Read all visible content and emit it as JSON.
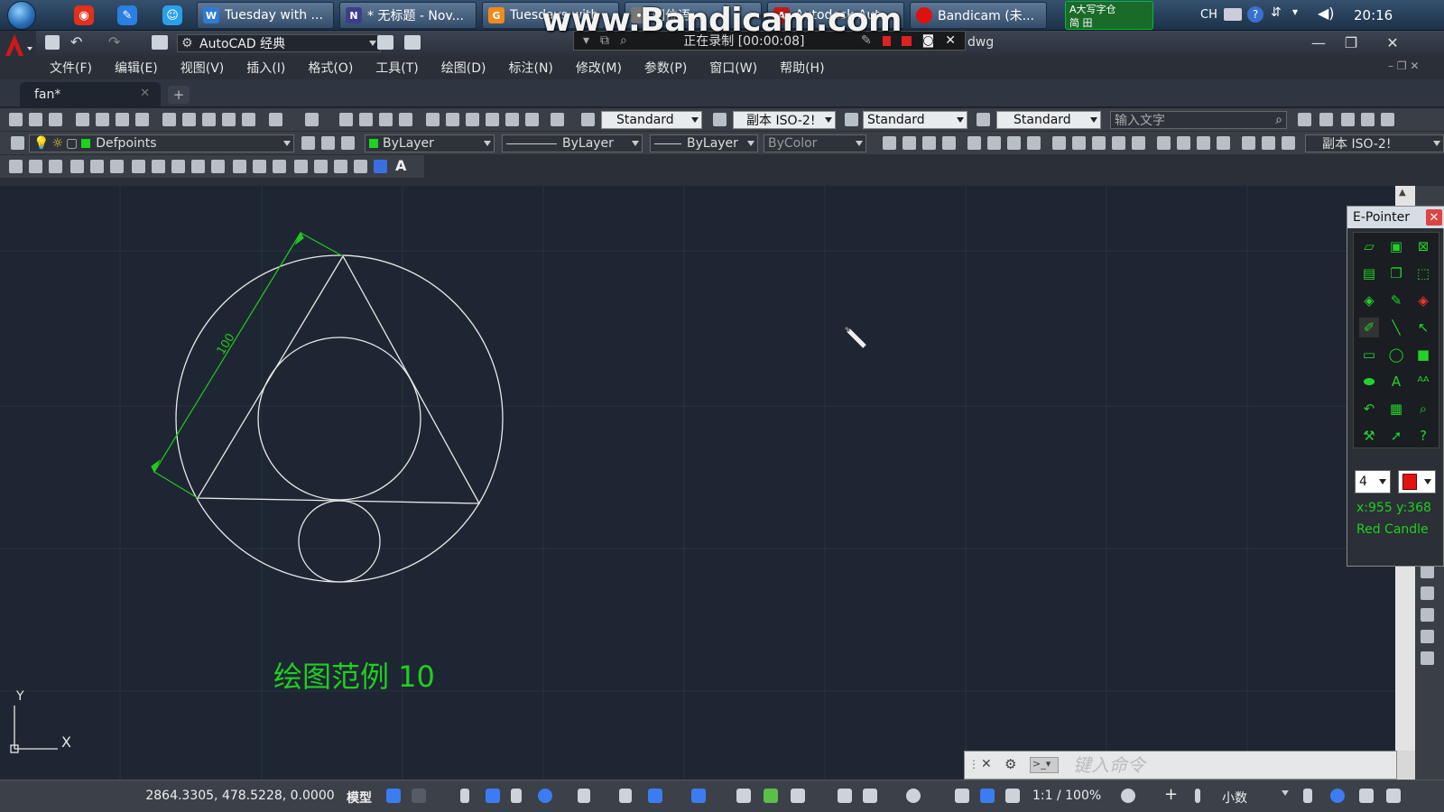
{
  "taskbar": {
    "windows": [
      {
        "label": "Tuesday with ...",
        "icon": "word-doc-icon",
        "color": "#2f7bd6"
      },
      {
        "label": "* 无标题 - Nov...",
        "icon": "notepad-icon",
        "color": "#3d3d8a"
      },
      {
        "label": "Tuesdays with ...",
        "icon": "orange-app-icon",
        "color": "#f08a1c"
      },
      {
        "label": "同位语 ...",
        "icon": "app-icon",
        "color": "#777"
      },
      {
        "label": "Autodesk Aut...",
        "icon": "autocad-icon",
        "color": "#c21a1a"
      },
      {
        "label": "Bandicam (未...",
        "icon": "bandicam-record-icon",
        "color": "#d11"
      }
    ],
    "ime": {
      "line1": "A大写字仓",
      "line2": "简 田"
    },
    "lang": "CH",
    "clock": "20:16"
  },
  "bandicam": {
    "watermark": "www.Bandicam.com",
    "status": "正在录制 [00:00:08]"
  },
  "titlebar": {
    "workspace": "AutoCAD 经典",
    "filename_tail": "dwg",
    "controls": [
      "—",
      "❐",
      "✕"
    ]
  },
  "menubar": {
    "items": [
      "文件(F)",
      "编辑(E)",
      "视图(V)",
      "插入(I)",
      "格式(O)",
      "工具(T)",
      "绘图(D)",
      "标注(N)",
      "修改(M)",
      "参数(P)",
      "窗口(W)",
      "帮助(H)"
    ]
  },
  "tabs": {
    "active": "fan*",
    "close": "✕",
    "add": "+"
  },
  "toolbar_std": {
    "text_style": "Standard",
    "dim_style": "副本 ISO-2!",
    "table_style": "Standard",
    "mleader_style": "Standard",
    "search_placeholder": "输入文字"
  },
  "toolbar_layers": {
    "layer": "Defpoints",
    "color": "ByLayer",
    "linetype": "ByLayer",
    "lineweight": "ByLayer",
    "plotstyle": "ByColor",
    "dim_style_right": "副本 ISO-2!"
  },
  "drawing": {
    "caption": "绘图范例 10",
    "dimension_text": "100",
    "ucs": {
      "y": "Y",
      "x": "X"
    },
    "line_color": "#e8e8e8",
    "dim_color": "#22c81f"
  },
  "epointer": {
    "title": "E-Pointer",
    "close": "✕",
    "width_value": "4",
    "color_value": "#e31212",
    "coords": "x:955  y:368",
    "pen_name": "Red Candle"
  },
  "cmdline": {
    "placeholder": "键入命令"
  },
  "statusbar": {
    "coords": "2864.3305, 478.5228, 0.0000",
    "model": "模型",
    "scale": "1:1 / 100%",
    "units": "小数"
  }
}
